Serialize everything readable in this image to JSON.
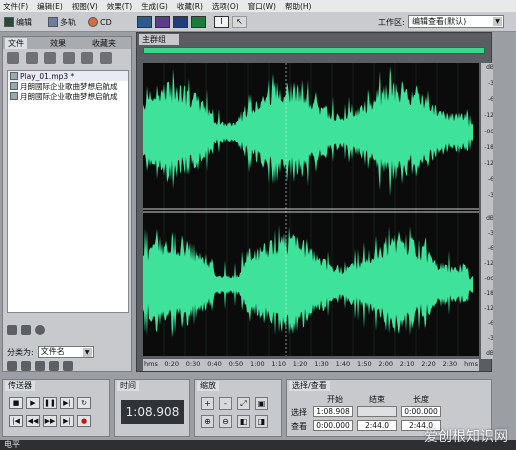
{
  "menu": [
    "文件(F)",
    "编辑(E)",
    "视图(V)",
    "效果(T)",
    "生成(G)",
    "收藏(R)",
    "选项(O)",
    "窗口(W)",
    "帮助(H)"
  ],
  "toolbar": {
    "edit_label": "编辑",
    "multitrack_label": "多轨",
    "cd_label": "CD",
    "workspace_label": "工作区:",
    "workspace_value": "编辑查看(默认)"
  },
  "left_panel": {
    "tabs": [
      "文件",
      "效果",
      "收藏夹"
    ],
    "files": [
      "Play_01.mp3 *",
      "月朗國际企业歌曲梦想启航成",
      "月朗國际企业歌曲梦想启航成"
    ],
    "sort_label": "分类为:",
    "sort_value": "文件名"
  },
  "editor": {
    "tab_label": "主群组",
    "time_ticks": [
      "hms",
      "0:20",
      "0:30",
      "0:40",
      "0:50",
      "1:00",
      "1:10",
      "1:20",
      "1:30",
      "1:40",
      "1:50",
      "2:00",
      "2:10",
      "2:20",
      "2:30",
      "hms"
    ],
    "db_labels_top": [
      "dB",
      "-3",
      "-6",
      "-12",
      "-oo",
      "-18",
      "-12",
      "-6",
      "-3"
    ],
    "db_labels_bottom": [
      "dB",
      "-3",
      "-6",
      "-12",
      "-oo",
      "-18",
      "-12",
      "-6",
      "-3",
      "dB"
    ],
    "wave_color": "#3fe29a",
    "background_color": "#0b0b0b"
  },
  "transport": {
    "title": "传送器"
  },
  "time": {
    "title": "时间",
    "value": "1:08.908"
  },
  "zoom": {
    "title": "缩放"
  },
  "selection": {
    "title": "选择/查看",
    "col_start": "开始",
    "col_end": "结束",
    "col_length": "长度",
    "row_select": "选择",
    "row_view": "查看",
    "select_start": "1:08.908",
    "select_end": "",
    "select_length": "0:00.000",
    "view_start": "0:00.000",
    "view_end": "2:44.0",
    "view_length": "2:44.0"
  },
  "level": {
    "title": "电平"
  },
  "watermark": "爱创根知识网"
}
